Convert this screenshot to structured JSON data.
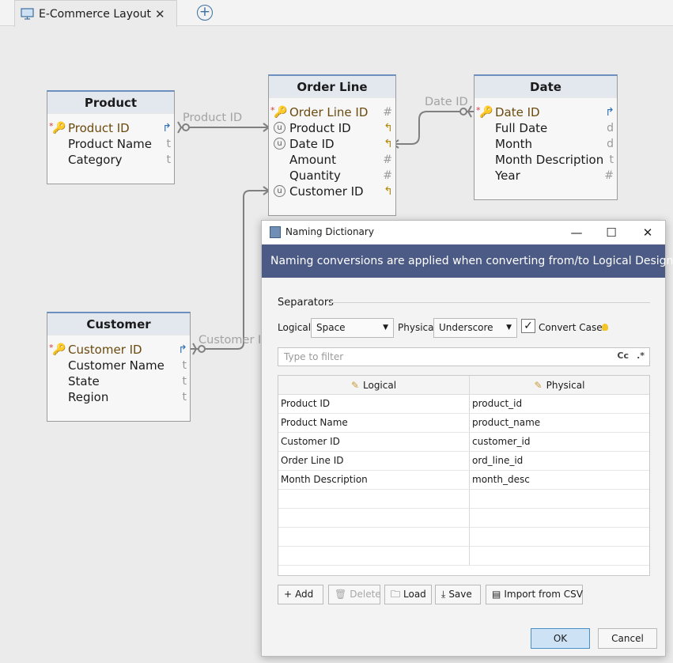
{
  "tab": {
    "title": "E-Commerce Layout",
    "close": "✕",
    "add": "+"
  },
  "relationships": [
    {
      "label": "Product ID"
    },
    {
      "label": "Date ID"
    },
    {
      "label": "Customer I"
    }
  ],
  "entities": {
    "product": {
      "title": "Product",
      "attributes": [
        {
          "name": "Product ID",
          "type": "",
          "pk": true
        },
        {
          "name": "Product Name",
          "type": "t"
        },
        {
          "name": "Category",
          "type": "t"
        }
      ]
    },
    "order_line": {
      "title": "Order Line",
      "attributes": [
        {
          "name": "Order Line ID",
          "type": "#",
          "pk": true
        },
        {
          "name": "Product ID",
          "type": ""
        },
        {
          "name": "Date ID",
          "type": ""
        },
        {
          "name": "Amount",
          "type": "#"
        },
        {
          "name": "Quantity",
          "type": "#"
        },
        {
          "name": "Customer ID",
          "type": ""
        }
      ]
    },
    "date": {
      "title": "Date",
      "attributes": [
        {
          "name": "Date ID",
          "type": "",
          "pk": true
        },
        {
          "name": "Full Date",
          "type": "d"
        },
        {
          "name": "Month",
          "type": "d"
        },
        {
          "name": "Month Description",
          "type": "t"
        },
        {
          "name": "Year",
          "type": "#"
        }
      ]
    },
    "customer": {
      "title": "Customer",
      "attributes": [
        {
          "name": "Customer ID",
          "type": "",
          "pk": true
        },
        {
          "name": "Customer Name",
          "type": "t"
        },
        {
          "name": "State",
          "type": "t"
        },
        {
          "name": "Region",
          "type": "t"
        }
      ]
    }
  },
  "dialog": {
    "title": "Naming Dictionary",
    "window_buttons": {
      "minimize": "—",
      "maximize": "☐",
      "close": "✕"
    },
    "banner": "Naming conversions are applied when converting from/to Logical Design.",
    "separators_label": "Separators",
    "logical_label": "Logical",
    "logical_value": "Space",
    "physical_label": "Physical",
    "physical_value": "Underscore",
    "convert_cases_label": "Convert Cases",
    "convert_cases_checked": "✓",
    "filter_placeholder": "Type to filter",
    "filter_cc": "Cc",
    "filter_regex": ".*",
    "table": {
      "headers": [
        "Logical",
        "Physical"
      ],
      "rows": [
        [
          "Product ID",
          "product_id"
        ],
        [
          "Product Name",
          "product_name"
        ],
        [
          "Customer ID",
          "customer_id"
        ],
        [
          "Order Line ID",
          "ord_line_id"
        ],
        [
          "Month Description",
          "month_desc"
        ],
        [
          "",
          ""
        ],
        [
          "",
          ""
        ],
        [
          "",
          ""
        ],
        [
          "",
          ""
        ]
      ]
    },
    "buttons": {
      "add": "Add",
      "delete": "Delete",
      "load": "Load",
      "save": "Save",
      "import_csv": "Import from CSV",
      "ok": "OK",
      "cancel": "Cancel"
    }
  },
  "colors": {
    "accent_blue": "#6d8fbd",
    "banner": "#4c5a86",
    "primary_key_text": "#6b4a0e",
    "link_line": "#808080"
  }
}
